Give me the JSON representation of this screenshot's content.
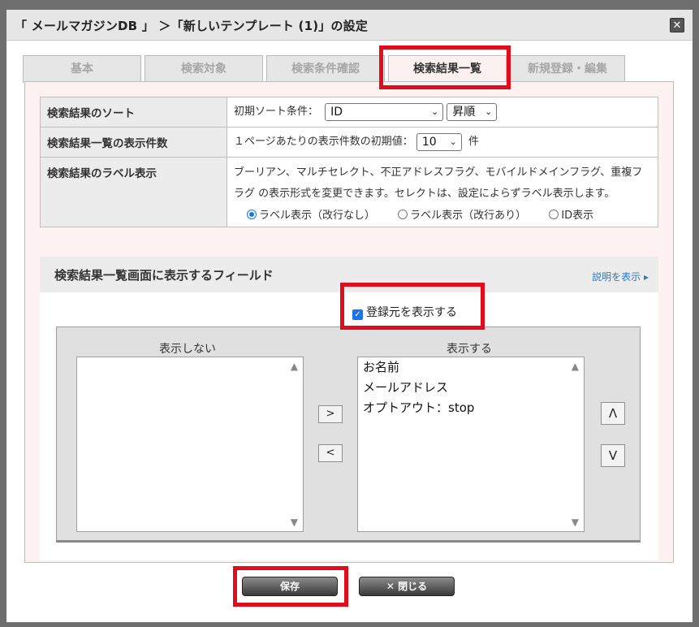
{
  "window": {
    "title": "「 メールマガジンDB 」 ＞「新しいテンプレート (1)」の設定",
    "close_glyph": "✕"
  },
  "tabs": [
    {
      "label": "基本",
      "active": false
    },
    {
      "label": "検索対象",
      "active": false
    },
    {
      "label": "検索条件確認",
      "active": false
    },
    {
      "label": "検索結果一覧",
      "active": true
    },
    {
      "label": "新規登録・編集",
      "active": false
    }
  ],
  "settings": {
    "sort": {
      "label": "検索結果のソート",
      "condition_label": "初期ソート条件：",
      "field_value": "ID",
      "order_value": "昇順"
    },
    "count": {
      "label": "検索結果一覧の表示件数",
      "prefix": "１ページあたりの表示件数の初期値：",
      "value": "10",
      "suffix": "件"
    },
    "label_display": {
      "label": "検索結果のラベル表示",
      "description": "ブーリアン、マルチセレクト、不正アドレスフラグ、モバイルドメインフラグ、重複フラグ の表示形式を変更できます。セレクトは、設定によらずラベル表示します。",
      "options": [
        {
          "label": "ラベル表示（改行なし）",
          "selected": true
        },
        {
          "label": "ラベル表示（改行あり）",
          "selected": false
        },
        {
          "label": "ID表示",
          "selected": false
        }
      ]
    }
  },
  "fields": {
    "heading": "検索結果一覧画面に表示するフィールド",
    "help_link": "説明を表示 ▸",
    "show_source_label": "登録元を表示する",
    "show_source_checked": true,
    "hidden_label": "表示しない",
    "shown_label": "表示する",
    "hidden_items": [],
    "shown_items": [
      "お名前",
      "メールアドレス",
      "オプトアウト：stop"
    ],
    "move_right": ">",
    "move_left": "<",
    "move_up": "Λ",
    "move_down": "V"
  },
  "footer": {
    "save_label": "保存",
    "close_label": "✕ 閉じる"
  },
  "colors": {
    "highlight": "#e00d1c",
    "accent": "#1a73e8",
    "link": "#2a7bc8"
  }
}
